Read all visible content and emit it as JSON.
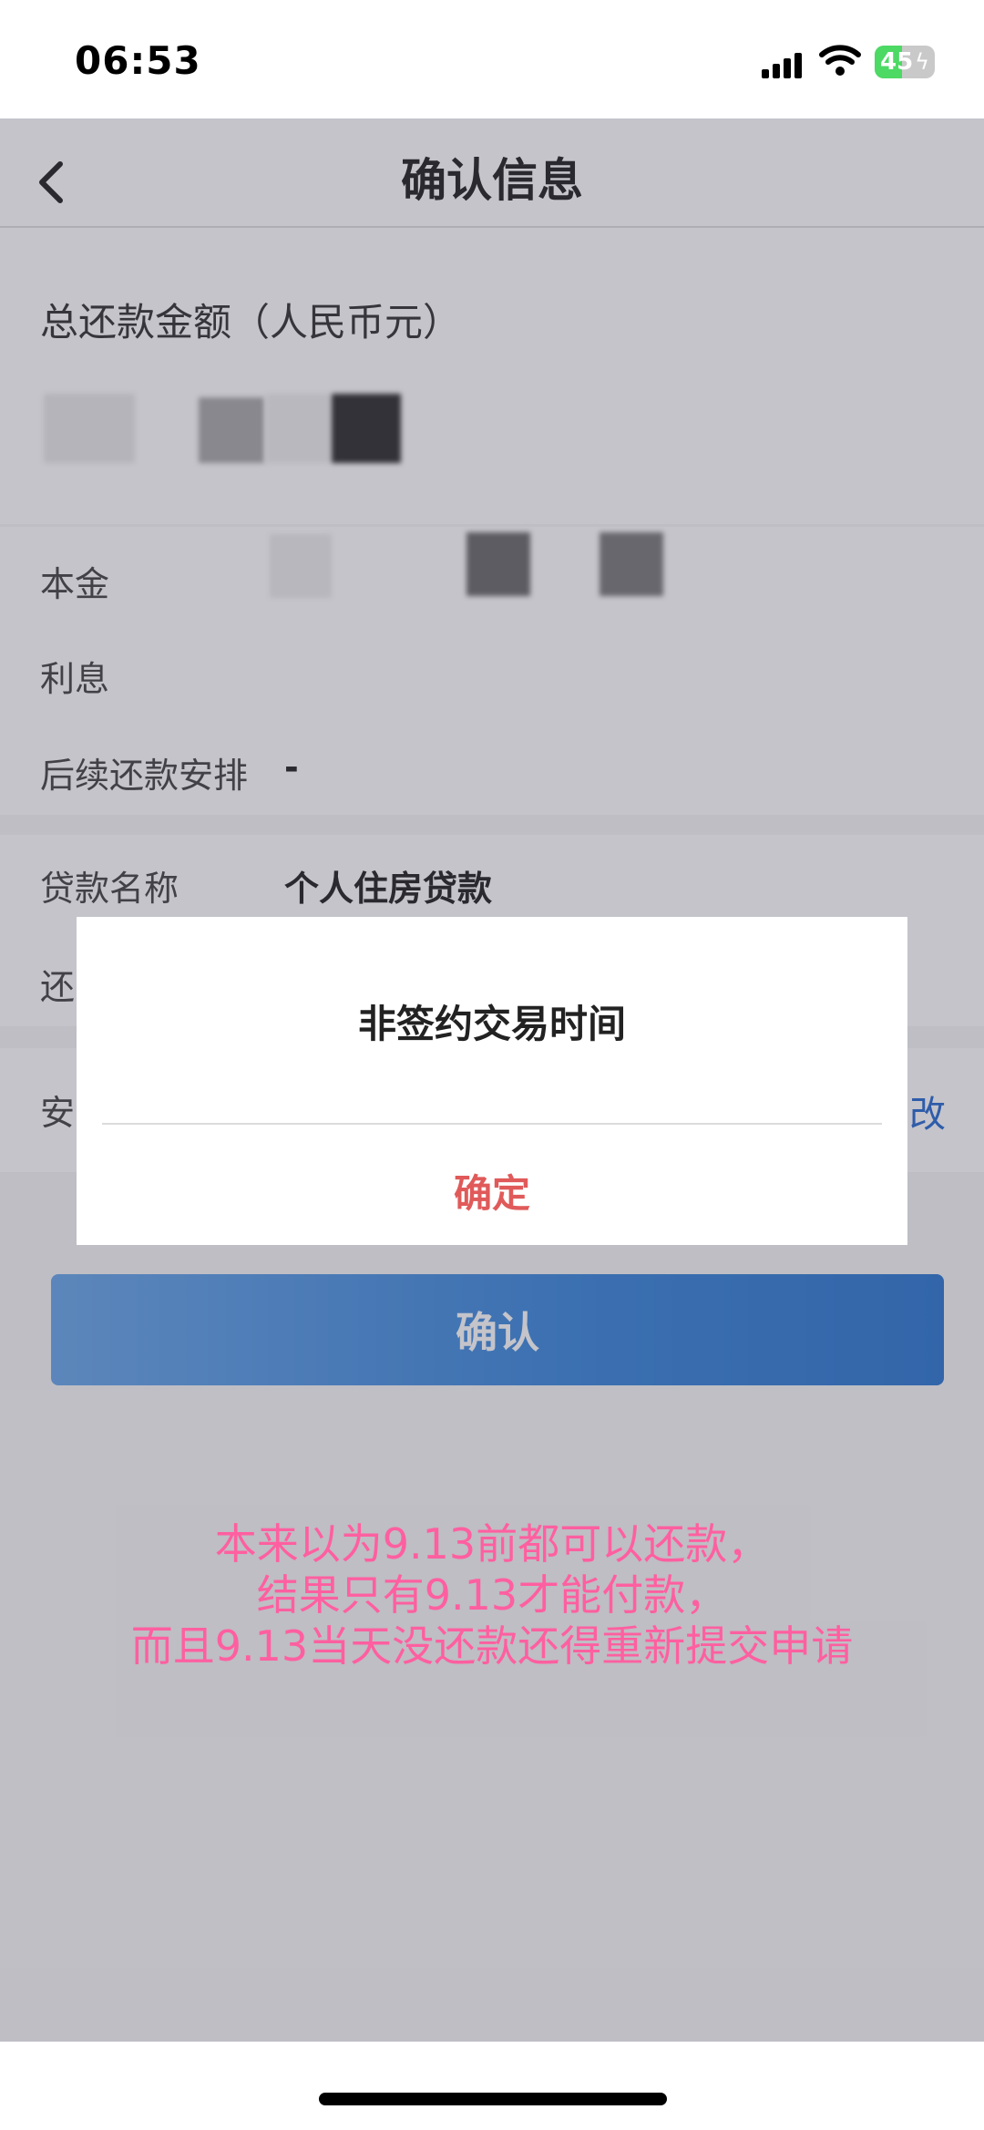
{
  "status_bar": {
    "time": "06:53",
    "battery": "45",
    "battery_level": 0.45
  },
  "header": {
    "title": "确认信息"
  },
  "summary": {
    "total_label": "总还款金额（人民币元）"
  },
  "breakdown": {
    "rows": [
      {
        "label": "本金",
        "value": ""
      },
      {
        "label": "利息",
        "value": ""
      },
      {
        "label": "后续还款安排",
        "value": "-"
      }
    ]
  },
  "loan": {
    "name_label": "贷款名称",
    "name_value": "个人住房贷款",
    "second_label_partial": "还"
  },
  "security": {
    "label_partial": "安",
    "modify_partial": "改"
  },
  "actions": {
    "confirm_label": "确认"
  },
  "dialog": {
    "title": "非签约交易时间",
    "ok_label": "确定"
  },
  "annotation": {
    "lines": [
      "本来以为9.13前都可以还款，",
      "结果只有9.13才能付款，",
      "而且9.13当天没还款还得重新提交申请"
    ],
    "color": "#ff5fa0"
  },
  "colors": {
    "primary": "#3b86db",
    "link": "#2a6bd2",
    "danger": "#e05a5a"
  }
}
